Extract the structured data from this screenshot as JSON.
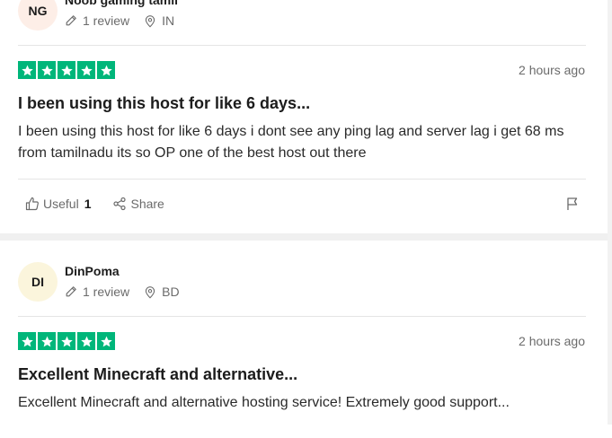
{
  "colors": {
    "star_green": "#00b67a",
    "avatar1_bg": "#fdeee7",
    "avatar2_bg": "#fbf5dc"
  },
  "reviews": [
    {
      "initials": "NG",
      "name": "Noob gaming tamil",
      "review_count": "1 review",
      "country": "IN",
      "rating": 5,
      "date": "2 hours ago",
      "title": "I been using this host for like 6 days...",
      "body": "I been using this host for like 6 days i dont see any ping lag and server lag i get 68 ms from tamilnadu its so OP one of the best host out there",
      "useful_label": "Useful",
      "useful_count": "1",
      "share_label": "Share"
    },
    {
      "initials": "DI",
      "name": "DinPoma",
      "review_count": "1 review",
      "country": "BD",
      "rating": 5,
      "date": "2 hours ago",
      "title": "Excellent Minecraft and alternative...",
      "body": "Excellent Minecraft and alternative hosting service! Extremely good support..."
    }
  ]
}
